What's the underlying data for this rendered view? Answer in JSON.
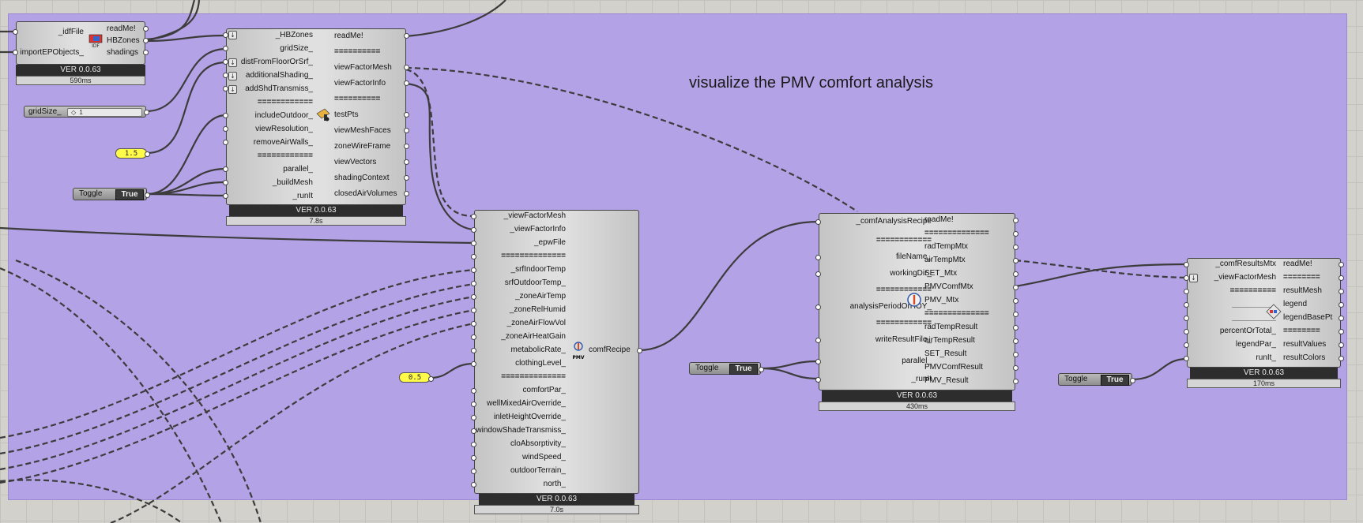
{
  "group": {
    "title": "visualize the PMV comfort analysis",
    "color": "#b4a2e6"
  },
  "importer": {
    "inputs": [
      "_idfFile",
      "importEPObjects_"
    ],
    "outputs": [
      "readMe!",
      "HBZones",
      "shadings"
    ],
    "icon": "idf-import-icon",
    "version": "VER 0.0.63",
    "timer": "590ms"
  },
  "viewfactor": {
    "inputs": [
      "_HBZones",
      "gridSize_",
      "distFromFloorOrSrf_",
      "additionalShading_",
      "addShdTransmiss_",
      "============",
      "includeOutdoor_",
      "viewResolution_",
      "removeAirWalls_",
      "============",
      "parallel_",
      "_buildMesh",
      "_runIt"
    ],
    "outputs": [
      "readMe!",
      "==========",
      "viewFactorMesh",
      "viewFactorInfo",
      "==========",
      "testPts",
      "viewMeshFaces",
      "zoneWireFrame",
      "viewVectors",
      "shadingContext",
      "closedAirVolumes"
    ],
    "icon": "view-factor-icon",
    "version": "VER 0.0.63",
    "timer": "7.8s"
  },
  "slider": {
    "label": "gridSize_",
    "value": "1"
  },
  "panel_1": {
    "value": "1.5"
  },
  "panel_2": {
    "value": "0.5"
  },
  "toggles": [
    {
      "label": "Toggle",
      "value": "True"
    },
    {
      "label": "Toggle",
      "value": "True"
    },
    {
      "label": "Toggle",
      "value": "True"
    }
  ],
  "recipe": {
    "inputs": [
      "_viewFactorMesh",
      "_viewFactorInfo",
      "_epwFile",
      "==============",
      "_srfIndoorTemp",
      "srfOutdoorTemp_",
      "_zoneAirTemp",
      "_zoneRelHumid",
      "_zoneAirFlowVol",
      "_zoneAirHeatGain",
      "metabolicRate_",
      "clothingLevel_",
      "==============",
      "comfortPar_",
      "wellMixedAirOverride_",
      "inletHeightOverride_",
      "windowShadeTransmiss_",
      "cloAbsorptivity_",
      "windSpeed_",
      "outdoorTerrain_",
      "north_"
    ],
    "outputs": [
      "comfRecipe"
    ],
    "icon": "pmv-icon",
    "icon_label": "PMV",
    "version": "VER 0.0.63",
    "timer": "7.0s"
  },
  "analysis": {
    "inputs": [
      "_comfAnalysisRecipe",
      "============",
      "fileName_",
      "workingDir_",
      "============",
      "analysisPeriodOrHOY_",
      "============",
      "writeResultFile_",
      "parallel_",
      "_runIt"
    ],
    "outputs": [
      "readMe!",
      "==============",
      "radTempMtx",
      "airTempMtx",
      "SET_Mtx",
      "PMVComfMtx",
      "PMV_Mtx",
      "==============",
      "radTempResult",
      "airTempResult",
      "SET_Result",
      "PMVComfResult",
      "PMV_Result"
    ],
    "icon": "comfort-analysis-icon",
    "version": "VER 0.0.63",
    "timer": "430ms"
  },
  "results": {
    "inputs": [
      "_comfResultsMtx",
      "_viewFactorMesh",
      "==========",
      "__________",
      "__________",
      "percentOrTotal_",
      "legendPar_",
      "runIt_"
    ],
    "outputs": [
      "readMe!",
      "========",
      "resultMesh",
      "legend",
      "legendBasePt",
      "========",
      "resultValues",
      "resultColors"
    ],
    "icon": "color-mesh-icon",
    "version": "VER 0.0.63",
    "timer": "170ms"
  }
}
